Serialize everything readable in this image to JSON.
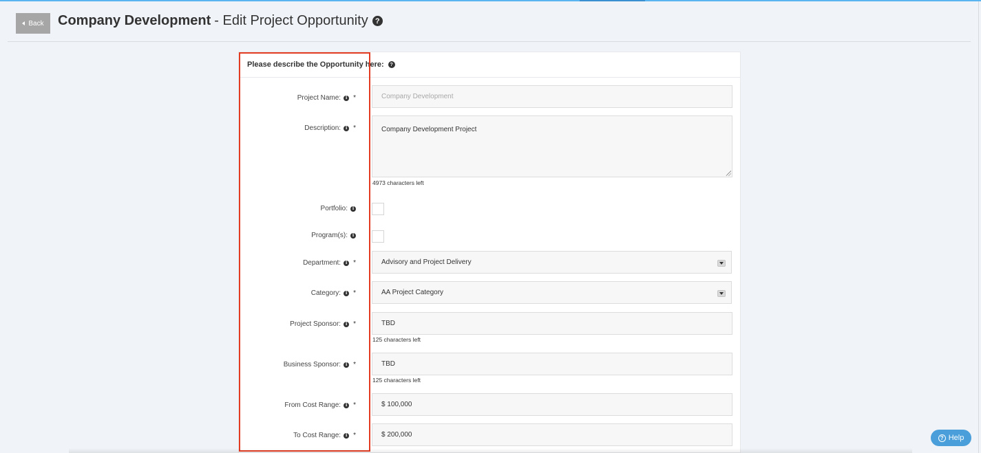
{
  "header": {
    "back_label": "Back",
    "title_strong": "Company Development",
    "title_sub": "- Edit Project Opportunity"
  },
  "panel": {
    "heading": "Please describe the Opportunity here:"
  },
  "fields": {
    "project_name": {
      "label": "Project Name:",
      "placeholder": "Company Development"
    },
    "description": {
      "label": "Description:",
      "value": "Company Development Project",
      "hint": "4973 characters left"
    },
    "portfolio": {
      "label": "Portfolio:"
    },
    "programs": {
      "label": "Program(s):"
    },
    "department": {
      "label": "Department:",
      "value": "Advisory and Project Delivery"
    },
    "category": {
      "label": "Category:",
      "value": "AA Project Category"
    },
    "project_sponsor": {
      "label": "Project Sponsor:",
      "value": "TBD",
      "hint": "125 characters left"
    },
    "business_sponsor": {
      "label": "Business Sponsor:",
      "value": "TBD",
      "hint": "125 characters left"
    },
    "from_cost": {
      "label": "From Cost Range:",
      "value": "$ 100,000"
    },
    "to_cost": {
      "label": "To Cost Range:",
      "value": "$ 200,000"
    }
  },
  "required_mark": "*",
  "help_button": {
    "label": "Help"
  },
  "colors": {
    "highlight": "#e33a22",
    "help_button": "#4a9fda",
    "back_button": "#a6a6a6",
    "background": "#f0f3f7"
  },
  "icons": {
    "title_help": "question-circle-icon",
    "field_info": "info-circle-icon",
    "select_arrow": "caret-down-icon"
  }
}
